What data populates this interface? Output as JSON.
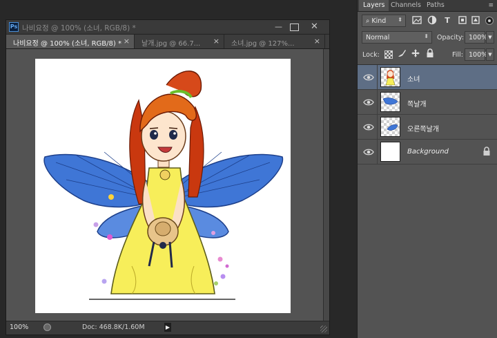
{
  "app": {
    "logo_text": "Ps"
  },
  "document_window": {
    "title": "나비요정 @ 100% (소녀, RGB/8) *",
    "tabs": [
      {
        "label": "나비요정 @ 100% (소녀, RGB/8) *",
        "active": true,
        "close": "×"
      },
      {
        "label": "날개.jpg @ 66.7...",
        "active": false,
        "close": "×"
      },
      {
        "label": "소녀.jpg @ 127%...",
        "active": false,
        "close": "×"
      }
    ],
    "controls": {
      "minimize": "—",
      "close": "✕"
    },
    "status": {
      "zoom": "100%",
      "doc_info": "Doc: 468.8K/1.60M",
      "arrow": "▶"
    }
  },
  "layers_panel": {
    "tabs": [
      "Layers",
      "Channels",
      "Paths"
    ],
    "active_tab": "Layers",
    "menu_icon": "≡",
    "filter": {
      "kind": "Kind",
      "kind_icon": "⌕",
      "arrow": "⬍"
    },
    "blend_mode": "Normal",
    "opacity_label": "Opacity:",
    "opacity": "100%",
    "lock_label": "Lock:",
    "fill_label": "Fill:",
    "fill": "100%",
    "dropdown_glyph": "▼",
    "layers": [
      {
        "name": "소녀",
        "visible": true,
        "selected": true,
        "thumbnail": "girl"
      },
      {
        "name": "쪽날개",
        "visible": true,
        "selected": false,
        "thumbnail": "wing-left"
      },
      {
        "name": "오른쪽날개",
        "visible": true,
        "selected": false,
        "thumbnail": "wing-right"
      },
      {
        "name": "Background",
        "visible": true,
        "selected": false,
        "thumbnail": "white",
        "locked": true,
        "italic": true
      }
    ]
  },
  "colors": {
    "accent_selected_layer": "#5e6e85",
    "panel_bg": "#535353",
    "app_bg": "#282828"
  }
}
